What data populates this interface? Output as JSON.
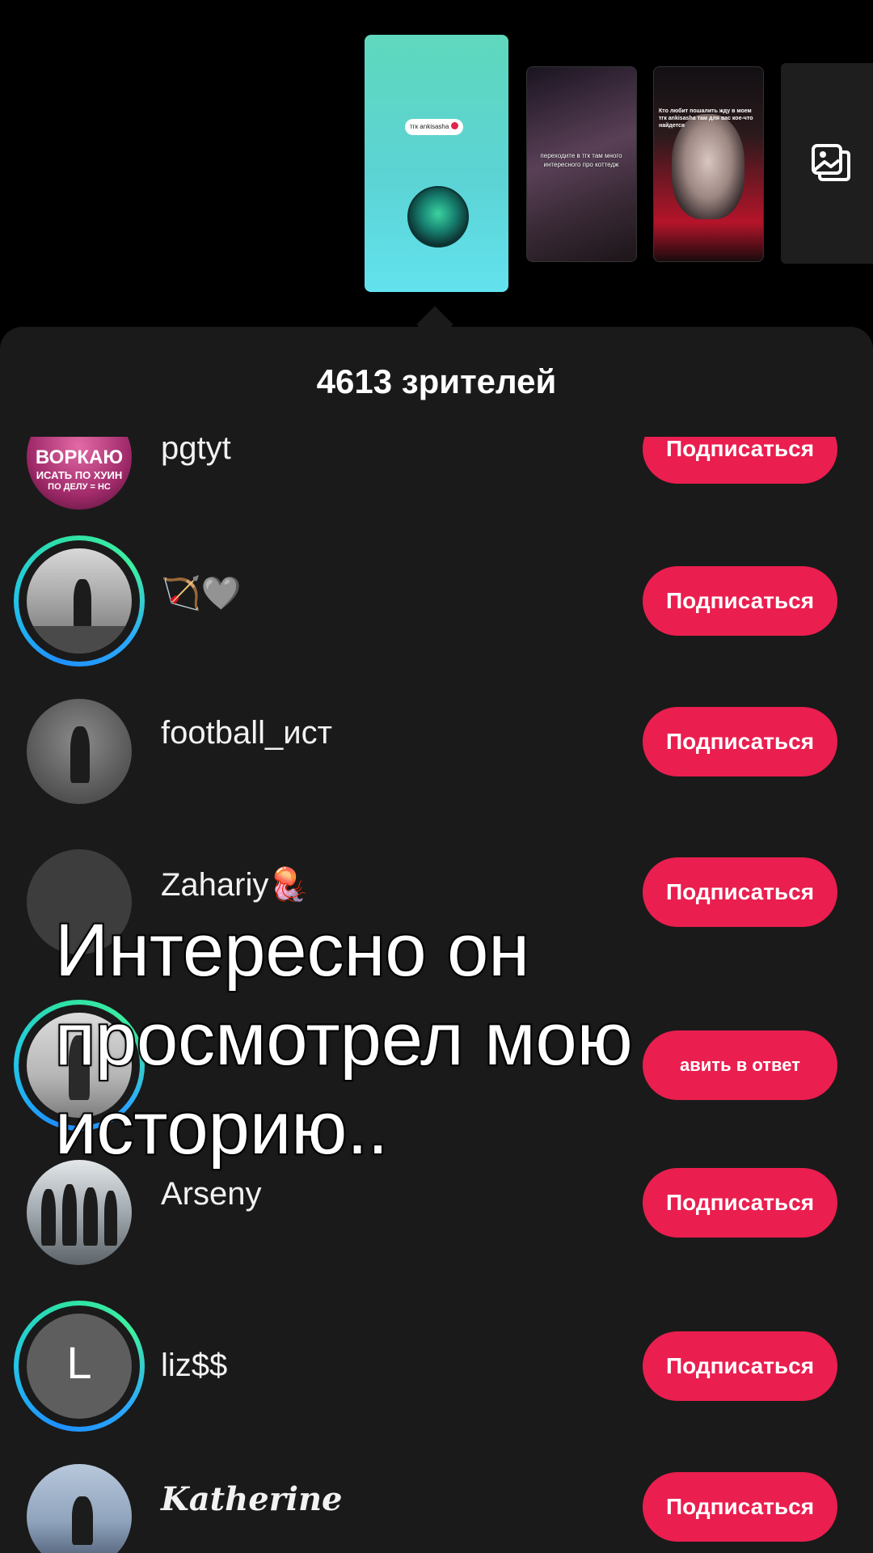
{
  "stories": {
    "current_tag": "тгк ankisasha",
    "story2_caption": "переходите в тгк там много интересного про коттедж",
    "story3_caption": "Кто любит пошалить жду в моем тгк ankisasha там для вас кое-что найдется"
  },
  "viewers": {
    "title": "4613 зрителей",
    "items": [
      {
        "username": "pgtyt",
        "button": "Подписаться",
        "avatar_text": "ВОРКАЮ ИСАТЬ ПО ХУИН ПО ДЕЛУ = НС"
      },
      {
        "username": "🏹🩶",
        "button": "Подписаться"
      },
      {
        "username": "football_ист",
        "button": "Подписаться"
      },
      {
        "username": "Zahariy🪼",
        "button": "Подписаться"
      },
      {
        "username": "",
        "button": "авить в ответ"
      },
      {
        "username": "Arseny",
        "button": "Подписаться"
      },
      {
        "username": "liz$$",
        "button": "Подписаться",
        "avatar_letter": "L"
      },
      {
        "username": "Katherine",
        "button": "Подписаться"
      }
    ]
  },
  "overlay": {
    "caption": "Интересно он просмотрел мою историю.."
  },
  "colors": {
    "accent": "#ea1e4f",
    "sheet_bg": "#1a1a1a",
    "ring_gradient": [
      "#1f8fff",
      "#2de0a6"
    ]
  },
  "icons": {
    "gallery": "gallery-icon"
  }
}
